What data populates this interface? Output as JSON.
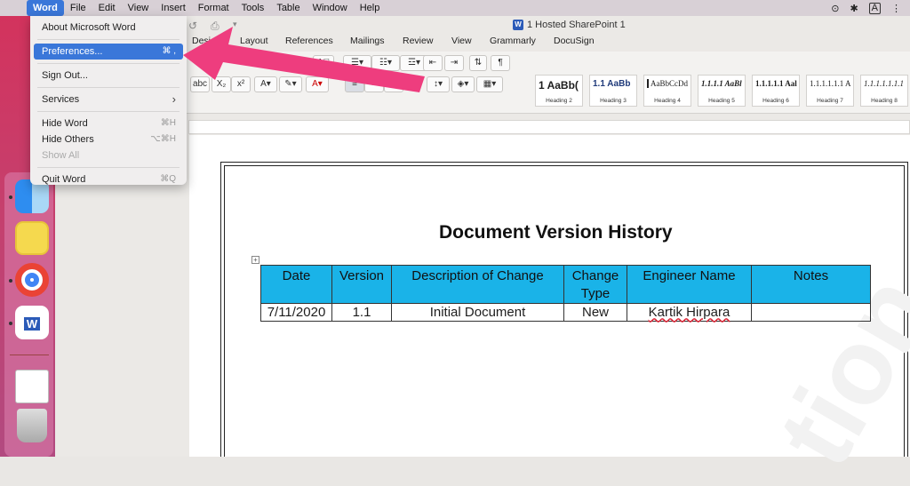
{
  "menubar": {
    "apple": "",
    "items": [
      "Word",
      "File",
      "Edit",
      "View",
      "Insert",
      "Format",
      "Tools",
      "Table",
      "Window",
      "Help"
    ],
    "right": {
      "a": "A"
    }
  },
  "window": {
    "title": "1 Hosted SharePoint 1",
    "tabs": [
      "Desi",
      "Layout",
      "References",
      "Mailings",
      "Review",
      "View",
      "Grammarly",
      "DocuSign"
    ]
  },
  "ribbon": {
    "styles": [
      {
        "preview": "1 AaBb(",
        "name": "Heading 2"
      },
      {
        "preview": "1.1 AaBb",
        "name": "Heading 3"
      },
      {
        "preview": "AaBbCcDd",
        "name": "Heading 4"
      },
      {
        "preview": "1.1.1.1 AaBl",
        "name": "Heading 5"
      },
      {
        "preview": "1.1.1.1.1 Aal",
        "name": "Heading 6"
      },
      {
        "preview": "1.1.1.1.1.1 A",
        "name": "Heading 7"
      },
      {
        "preview": "1.1.1.1.1.1.1",
        "name": "Heading 8"
      }
    ],
    "buttons": {
      "abc": "abc",
      "x2s": "X₂",
      "x2": "x²",
      "para": "¶"
    }
  },
  "document": {
    "title": "Document Version History",
    "table": {
      "headers": [
        "Date",
        "Version",
        "Description of Change",
        "Change Type",
        "Engineer Name",
        "Notes"
      ],
      "rows": [
        [
          "7/11/2020",
          "1.1",
          "Initial Document",
          "New",
          "Kartik Hirpara",
          ""
        ]
      ]
    }
  },
  "word_menu": {
    "items": [
      {
        "label": "About Microsoft Word",
        "shortcut": ""
      },
      {
        "label": "Preferences...",
        "shortcut": "⌘ ,"
      },
      {
        "label": "Sign Out...",
        "shortcut": ""
      },
      {
        "label": "Services",
        "shortcut": "›"
      },
      {
        "label": "Hide Word",
        "shortcut": "⌘H"
      },
      {
        "label": "Hide Others",
        "shortcut": "⌥⌘H"
      },
      {
        "label": "Show All",
        "shortcut": ""
      },
      {
        "label": "Quit Word",
        "shortcut": "⌘Q"
      }
    ]
  },
  "colors": {
    "menu_highlight": "#3a77d9",
    "table_header": "#1ab3e8",
    "arrow": "#ee3d7e"
  },
  "dock": {
    "icons": [
      "finder-icon",
      "stickies-icon",
      "chrome-icon",
      "word-icon",
      "file-stack-icon",
      "trash-icon"
    ]
  }
}
